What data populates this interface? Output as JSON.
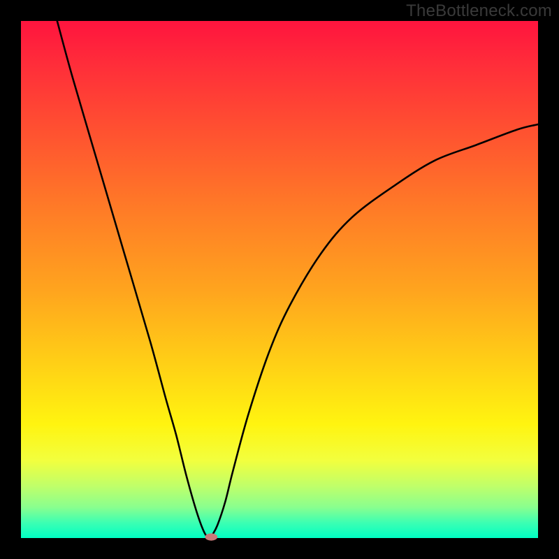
{
  "watermark": "TheBottleneck.com",
  "chart_data": {
    "type": "line",
    "title": "",
    "xlabel": "",
    "ylabel": "",
    "xlim": [
      0,
      100
    ],
    "ylim": [
      0,
      100
    ],
    "grid": false,
    "series": [
      {
        "name": "curve",
        "color": "#000000",
        "x": [
          7,
          10,
          15,
          20,
          25,
          28,
          30,
          32,
          34,
          35.5,
          36.5,
          37,
          38,
          39.5,
          41,
          44,
          48,
          52,
          58,
          64,
          72,
          80,
          88,
          96,
          100
        ],
        "y": [
          100,
          89,
          72,
          55,
          38,
          27,
          20,
          12,
          5,
          1,
          0,
          0.6,
          2.5,
          7,
          13,
          24,
          36,
          45,
          55,
          62,
          68,
          73,
          76,
          79,
          80
        ]
      }
    ],
    "marker": {
      "x": 36.8,
      "y": 0.2,
      "rx": 1.2,
      "ry": 0.7,
      "color": "#c97a7a"
    }
  }
}
